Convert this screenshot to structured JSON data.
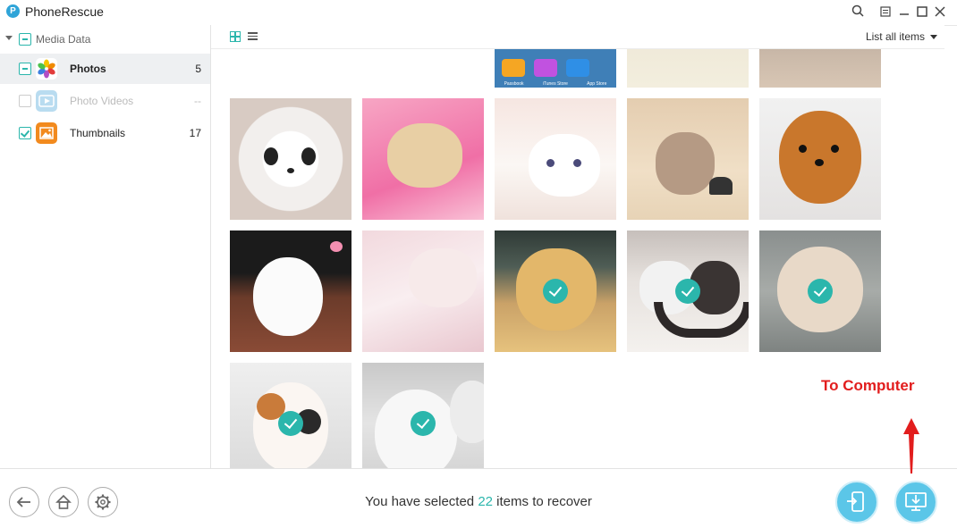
{
  "app": {
    "title": "PhoneRescue",
    "logo_letter": "P"
  },
  "titlebar_icons": [
    "search-icon",
    "menu-icon",
    "minimize-icon",
    "maximize-icon",
    "close-icon"
  ],
  "sidebar": {
    "group_label": "Media Data",
    "items": [
      {
        "label": "Photos",
        "count": "5",
        "state": "partial",
        "active": true,
        "icon": "photos-icon"
      },
      {
        "label": "Photo Videos",
        "count": "--",
        "state": "disabled",
        "active": false,
        "icon": "photo-videos-icon"
      },
      {
        "label": "Thumbnails",
        "count": "17",
        "state": "checked",
        "active": false,
        "icon": "thumbnails-icon"
      }
    ]
  },
  "viewbar": {
    "filter_label": "List all items"
  },
  "grid": {
    "partial_row_labels": [
      "Passbook",
      "iTunes Store",
      "App Store"
    ],
    "thumbnails": [
      {
        "subject": "panda puppy",
        "selected": false
      },
      {
        "subject": "sleeping puppy",
        "selected": false
      },
      {
        "subject": "white kitten",
        "selected": false
      },
      {
        "subject": "kitten with butterfly",
        "selected": false
      },
      {
        "subject": "pomeranian",
        "selected": false
      },
      {
        "subject": "white pomeranian",
        "selected": false
      },
      {
        "subject": "pink kitten",
        "selected": false
      },
      {
        "subject": "golden puppy",
        "selected": true
      },
      {
        "subject": "two cats",
        "selected": true
      },
      {
        "subject": "hamster",
        "selected": true
      },
      {
        "subject": "calico kitten",
        "selected": true
      },
      {
        "subject": "white puppy",
        "selected": true
      }
    ]
  },
  "bottom": {
    "status_prefix": "You have selected ",
    "status_count": "22",
    "status_suffix": " items to recover"
  },
  "annotation": {
    "text": "To Computer",
    "color": "#e21d1d"
  },
  "colors": {
    "accent": "#2bb6ac",
    "action": "#5bc6e8"
  }
}
